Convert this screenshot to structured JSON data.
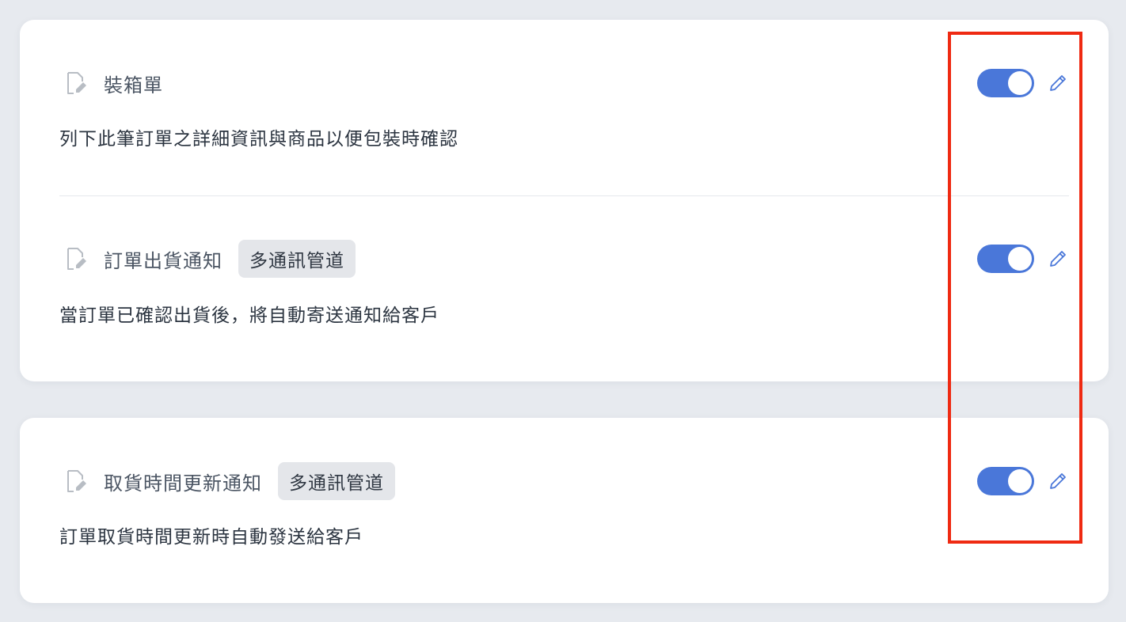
{
  "colors": {
    "background": "#e7eaef",
    "card": "#ffffff",
    "toggle_on": "#4a77d9",
    "tag_bg": "#e4e6ea",
    "highlight": "#ef2a12"
  },
  "cards": [
    {
      "items": [
        {
          "icon": "document-edit-icon",
          "title": "裝箱單",
          "tag": "",
          "description": "列下此筆訂單之詳細資訊與商品以便包裝時確認",
          "enabled": true,
          "edit_icon": "pencil-icon"
        },
        {
          "icon": "document-edit-icon",
          "title": "訂單出貨通知",
          "tag": "多通訊管道",
          "description": "當訂單已確認出貨後，將自動寄送通知給客戶",
          "enabled": true,
          "edit_icon": "pencil-icon"
        }
      ]
    },
    {
      "items": [
        {
          "icon": "document-edit-icon",
          "title": "取貨時間更新通知",
          "tag": "多通訊管道",
          "description": "訂單取貨時間更新時自動發送給客戶",
          "enabled": true,
          "edit_icon": "pencil-icon"
        }
      ]
    }
  ]
}
